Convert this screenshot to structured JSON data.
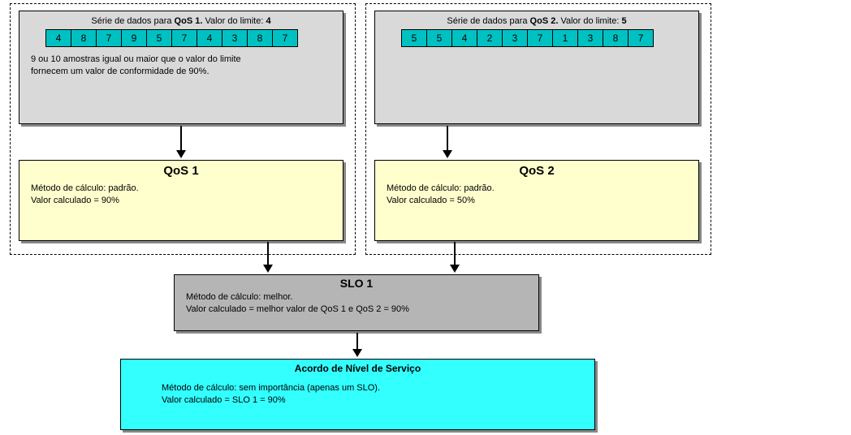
{
  "qos1": {
    "series_label_prefix": "Série de dados para ",
    "series_label_bold": "QoS 1.",
    "threshold_label": "   Valor do limite: ",
    "threshold_value": "4",
    "values": [
      "4",
      "8",
      "7",
      "9",
      "5",
      "7",
      "4",
      "3",
      "8",
      "7"
    ],
    "note_line1": "9 ou 10 amostras igual ou maior que o valor do limite",
    "note_line2": "fornecem um valor de conformidade de 90%.",
    "title": "QoS 1",
    "method": "Método de cálculo: padrão.",
    "calc": "Valor calculado = 90%"
  },
  "qos2": {
    "series_label_prefix": "Série de dados para ",
    "series_label_bold": "QoS 2.",
    "threshold_label": "   Valor do limite: ",
    "threshold_value": "5",
    "values": [
      "5",
      "5",
      "4",
      "2",
      "3",
      "7",
      "1",
      "3",
      "8",
      "7"
    ],
    "title": "QoS 2",
    "method": "Método de cálculo: padrão.",
    "calc": "Valor calculado = 50%"
  },
  "slo": {
    "title": "SLO 1",
    "method": "Método de cálculo: melhor.",
    "calc": "Valor calculado = melhor valor de QoS 1 e QoS 2 = 90%"
  },
  "sla": {
    "title": "Acordo de Nível de Serviço",
    "method": "Método de cálculo: sem importância (apenas um SLO).",
    "calc": "Valor calculado = SLO 1 = 90%"
  }
}
